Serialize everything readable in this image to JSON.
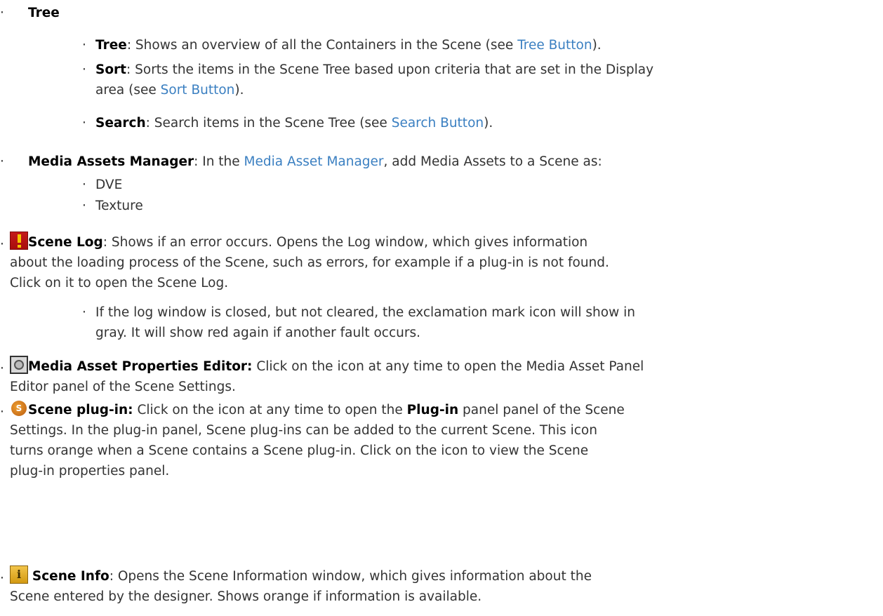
{
  "items": {
    "tree": {
      "title": "Tree"
    },
    "tree_sub": {
      "tree_label": "Tree",
      "tree_text": ": Shows an overview of all the Containers in the Scene (see ",
      "tree_link": "Tree Button",
      "tree_end": ").",
      "sort_label": "Sort",
      "sort_text_line1": ": Sorts the items in the Scene Tree based upon criteria that are set in the Display",
      "sort_text_line2": "area (see ",
      "sort_link": "Sort Button",
      "sort_end": ").",
      "search_label": "Search",
      "search_text": ": Search items in the Scene Tree (see ",
      "search_link": "Search Button",
      "search_end": ")."
    },
    "media_assets": {
      "label": "Media Assets Manager",
      "text_before": ": In the ",
      "link": "Media Asset Manager",
      "text_after": ", add Media Assets to a Scene as:",
      "sub": [
        "DVE",
        "Texture"
      ]
    },
    "scene_log": {
      "icon": "exclamation-icon",
      "label": "Scene Log",
      "line1": ": Shows if an error occurs. Opens the Log window, which gives information",
      "line2": "about the loading process of the Scene, such as errors, for example if a plug-in is not found.",
      "line3": "Click on it to open the Scene Log.",
      "sub_line1": "If the log window is closed, but not cleared, the exclamation mark icon will show in",
      "sub_line2": "gray. It will show red again if another fault occurs."
    },
    "media_asset_props": {
      "icon": "film-icon",
      "label": "Media Asset Properties Editor:",
      "line1": " Click on the icon at any time to open the Media Asset Panel",
      "line2": "Editor panel of the Scene Settings."
    },
    "scene_plugin": {
      "icon": "plugin-icon",
      "label": "Scene plug-in:",
      "line1a": " Click on the icon at any time to open the ",
      "line1b": "Plug-in",
      "line1c": " panel panel of the Scene",
      "line2": "Settings. In the plug-in panel, Scene plug-ins can be added to the current Scene. This icon",
      "line3": "turns orange when a Scene contains a Scene plug-in. Click on the icon to view the Scene",
      "line4": "plug-in properties panel."
    },
    "scene_info": {
      "icon": "info-icon",
      "label": "Scene Info",
      "line1": ": Opens the Scene Information window, which gives information about the",
      "line2": "Scene entered by the designer. Shows orange if information is available."
    }
  },
  "bullet_char": "·"
}
